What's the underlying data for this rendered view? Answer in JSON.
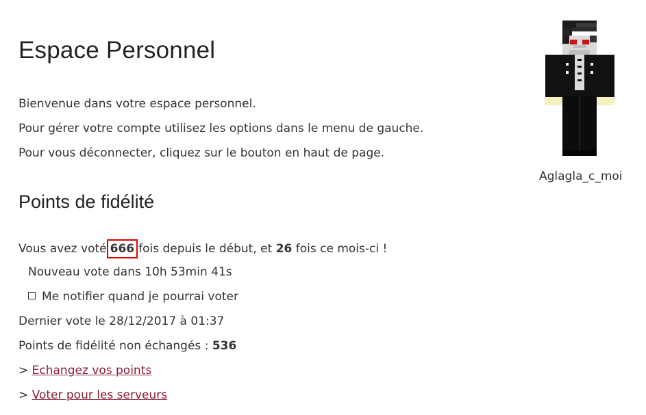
{
  "page": {
    "title": "Espace Personnel"
  },
  "intro": {
    "line1": "Bienvenue dans votre espace personnel.",
    "line2": "Pour gérer votre compte utilisez les options dans le menu de gauche.",
    "line3": "Pour vous déconnecter, cliquez sur le bouton en haut de page."
  },
  "profile": {
    "username": "Aglagla_c_moi",
    "avatar_icon": "minecraft-skin-icon"
  },
  "fidelity": {
    "title": "Points de fidélité",
    "votes_prefix": "Vous avez voté",
    "votes_total": "666",
    "votes_middle": "fois depuis le début, et",
    "votes_month": "26",
    "votes_suffix": "fois ce mois-ci !",
    "next_vote": "Nouveau vote dans 10h 53min 41s",
    "notify_label": "Me notifier quand je pourrai voter",
    "last_vote": "Dernier vote le 28/12/2017 à 01:37",
    "points_label": "Points de fidélité non échangés :",
    "points_value": "536",
    "link_prefix": ">",
    "exchange_link": "Echangez vos points",
    "vote_link": "Voter pour les serveurs"
  },
  "colors": {
    "link": "#8a1c3a",
    "highlight_border": "#e00000",
    "text": "#333333"
  }
}
